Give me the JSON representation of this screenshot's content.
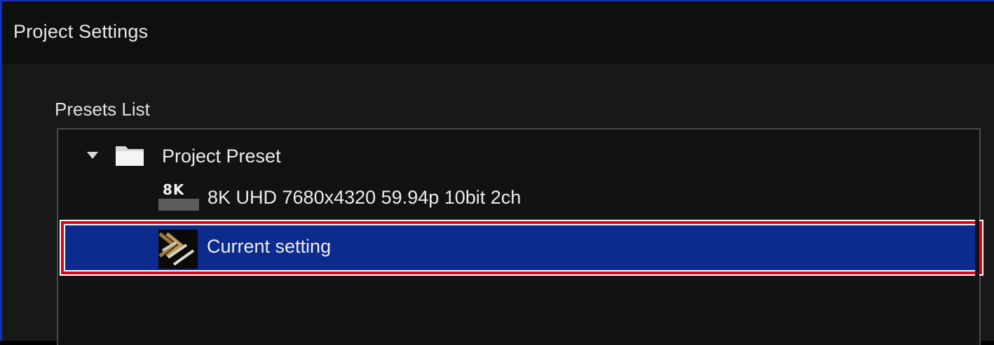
{
  "window": {
    "title": "Project Settings"
  },
  "presets": {
    "section_label": "Presets List",
    "folder": {
      "label": "Project Preset",
      "expanded": true
    },
    "items": [
      {
        "badge": "8K",
        "label": "8K UHD 7680x4320 59.94p 10bit 2ch",
        "icon": "8k-badge-icon",
        "selected": false
      },
      {
        "label": "Current setting",
        "icon": "chevrons-logo-icon",
        "selected": true
      }
    ]
  },
  "colors": {
    "selection": "#0b2c8c",
    "highlight_frame": "#e0001a",
    "window_border": "#1530b8"
  }
}
